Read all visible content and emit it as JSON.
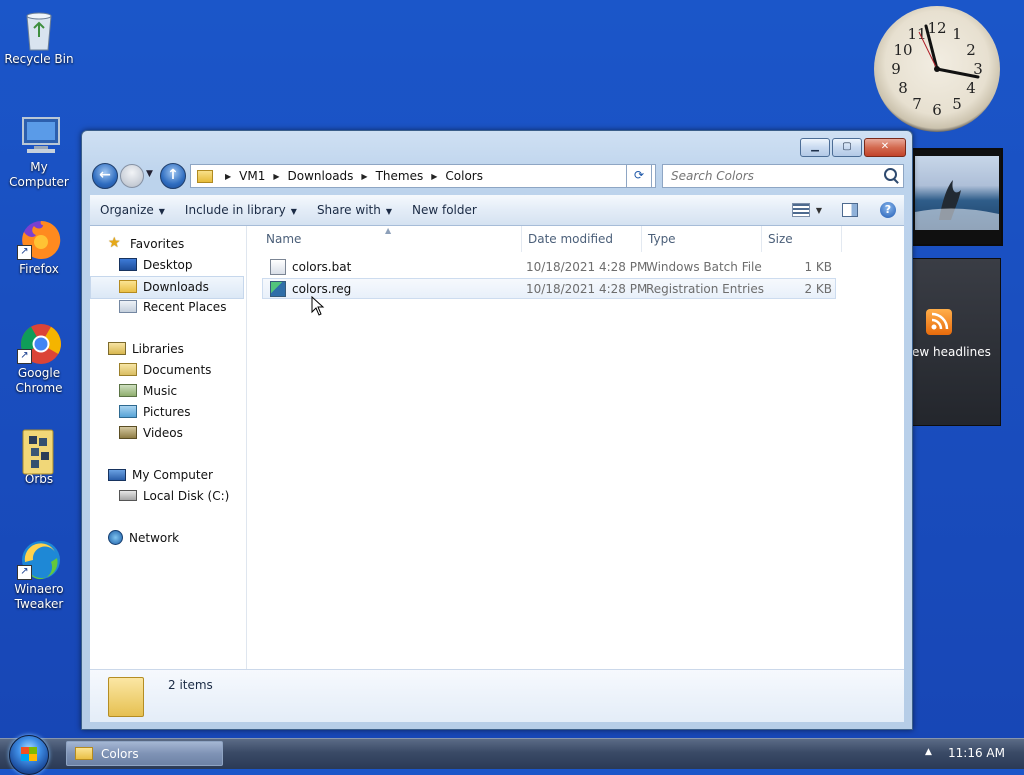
{
  "desktop": {
    "icons": [
      {
        "label": "Recycle Bin",
        "icon": "recycle-bin-icon"
      },
      {
        "label": "My Computer",
        "icon": "computer-icon"
      },
      {
        "label": "Firefox",
        "icon": "firefox-icon"
      },
      {
        "label": "Google Chrome",
        "icon": "chrome-icon"
      },
      {
        "label": "Orbs",
        "icon": "folder-icon"
      },
      {
        "label": "Winaero Tweaker",
        "icon": "winaero-icon"
      }
    ]
  },
  "gadgets": {
    "clock_numbers": [
      "12",
      "1",
      "2",
      "3",
      "4",
      "5",
      "6",
      "7",
      "8",
      "9",
      "10",
      "11"
    ],
    "feed_text": "ew headlines"
  },
  "window": {
    "breadcrumb": [
      "VM1",
      "Downloads",
      "Themes",
      "Colors"
    ],
    "search_placeholder": "Search Colors",
    "toolbar": {
      "organize": "Organize",
      "include_in_library": "Include in library",
      "share_with": "Share with",
      "new_folder": "New folder"
    },
    "nav": {
      "favorites": "Favorites",
      "desktop": "Desktop",
      "downloads": "Downloads",
      "recent_places": "Recent Places",
      "libraries": "Libraries",
      "documents": "Documents",
      "music": "Music",
      "pictures": "Pictures",
      "videos": "Videos",
      "my_computer": "My Computer",
      "local_disk": "Local Disk (C:)",
      "network": "Network"
    },
    "columns": {
      "name": "Name",
      "date": "Date modified",
      "type": "Type",
      "size": "Size"
    },
    "files": [
      {
        "name": "colors.bat",
        "date": "10/18/2021 4:28 PM",
        "type": "Windows Batch File",
        "size": "1 KB"
      },
      {
        "name": "colors.reg",
        "date": "10/18/2021 4:28 PM",
        "type": "Registration Entries",
        "size": "2 KB"
      }
    ],
    "status": "2 items"
  },
  "taskbar": {
    "task_label": "Colors",
    "time": "11:16 AM"
  }
}
